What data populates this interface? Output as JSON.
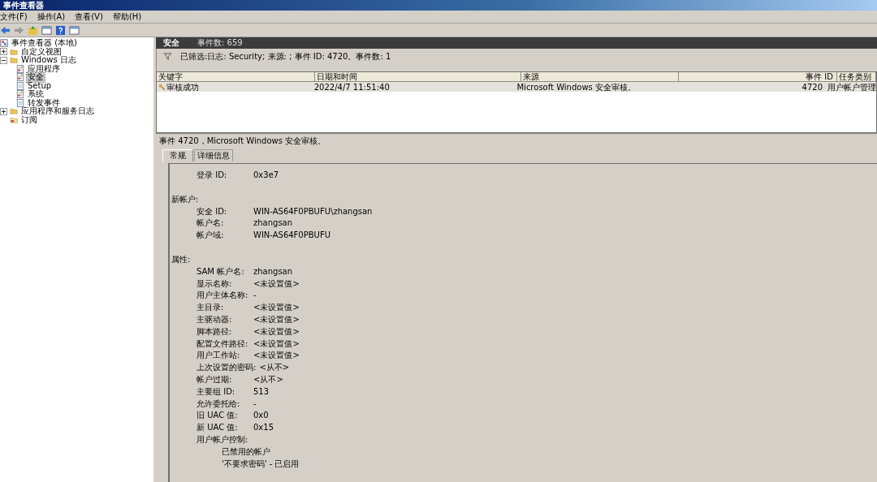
{
  "window": {
    "title": "事件查看器"
  },
  "menu": [
    "文件(F)",
    "操作(A)",
    "查看(V)",
    "帮助(H)"
  ],
  "tree": [
    {
      "label": "事件查看器 (本地)",
      "kind": "root",
      "selected": false,
      "children": [
        {
          "label": "自定义视图",
          "kind": "folder",
          "selected": false,
          "expanded": false
        },
        {
          "label": "Windows 日志",
          "kind": "folder",
          "selected": false,
          "expanded": true,
          "children": [
            {
              "label": "应用程序",
              "kind": "log",
              "selected": false
            },
            {
              "label": "安全",
              "kind": "log",
              "selected": true
            },
            {
              "label": "Setup",
              "kind": "plain",
              "selected": false
            },
            {
              "label": "系统",
              "kind": "log",
              "selected": false
            },
            {
              "label": "转发事件",
              "kind": "plain",
              "selected": false
            }
          ]
        },
        {
          "label": "应用程序和服务日志",
          "kind": "folder",
          "selected": false,
          "expanded": false
        },
        {
          "label": "订阅",
          "kind": "subscription",
          "selected": false
        }
      ]
    }
  ],
  "header": {
    "log": "安全",
    "count": "事件数: 659"
  },
  "filter": "已筛选:日志: Security; 来源: ; 事件 ID: 4720。事件数: 1",
  "table": {
    "columns": [
      "关键字",
      "日期和时间",
      "来源",
      "事件 ID",
      "任务类别"
    ],
    "rows": [
      {
        "selected": true,
        "cells": [
          "审核成功",
          "2022/4/7 11:51:40",
          "Microsoft Windows 安全审核。",
          "4720",
          "用户帐户管理"
        ]
      }
    ]
  },
  "event_title": "事件 4720，Microsoft Windows 安全审核。",
  "tabs": [
    {
      "label": "常规",
      "selected": true
    },
    {
      "label": "详细信息",
      "selected": false
    }
  ],
  "details": [
    {
      "kind": "field",
      "label": "登录 ID:",
      "value": "0x3e7"
    },
    {
      "kind": "section",
      "label": "新帐户:"
    },
    {
      "kind": "field",
      "label": "安全 ID:",
      "value": "WIN-AS64F0PBUFU\\zhangsan"
    },
    {
      "kind": "field",
      "label": "帐户名:",
      "value": "zhangsan"
    },
    {
      "kind": "field",
      "label": "帐户域:",
      "value": "WIN-AS64F0PBUFU"
    },
    {
      "kind": "section",
      "label": "属性:"
    },
    {
      "kind": "field",
      "label": "SAM 帐户名:",
      "value": "zhangsan"
    },
    {
      "kind": "field",
      "label": "显示名称:",
      "value": "<未设置值>"
    },
    {
      "kind": "field",
      "label": "用户主体名称:",
      "value": "-"
    },
    {
      "kind": "field",
      "label": "主目录:",
      "value": "<未设置值>"
    },
    {
      "kind": "field",
      "label": "主驱动器:",
      "value": "<未设置值>"
    },
    {
      "kind": "field",
      "label": "脚本路径:",
      "value": "<未设置值>"
    },
    {
      "kind": "field",
      "label": "配置文件路径:",
      "value": "<未设置值>"
    },
    {
      "kind": "field",
      "label": "用户工作站:",
      "value": "<未设置值>"
    },
    {
      "kind": "field",
      "label": "上次设置的密码:",
      "value": "<从不>"
    },
    {
      "kind": "field",
      "label": "帐户过期:",
      "value": "<从不>"
    },
    {
      "kind": "field",
      "label": "主要组 ID:",
      "value": "513"
    },
    {
      "kind": "field",
      "label": "允许委托给:",
      "value": "-"
    },
    {
      "kind": "field",
      "label": "旧 UAC 值:",
      "value": "0x0"
    },
    {
      "kind": "field",
      "label": "新 UAC 值:",
      "value": "0x15"
    },
    {
      "kind": "field",
      "label": "用户帐户控制:"
    },
    {
      "kind": "flag",
      "label": "已禁用的帐户"
    },
    {
      "kind": "flag",
      "label": "'不要求密码' - 已启用"
    }
  ]
}
